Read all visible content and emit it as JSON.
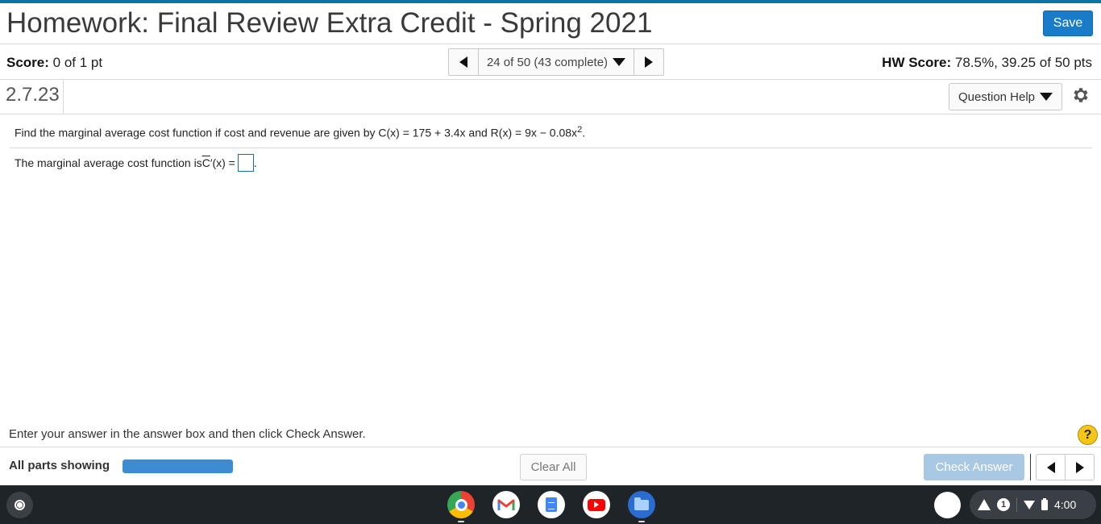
{
  "header": {
    "title": "Homework: Final Review Extra Credit - Spring 2021",
    "save_label": "Save"
  },
  "score_bar": {
    "score_label": "Score:",
    "score_value": "0 of 1 pt",
    "question_position": "24 of 50 (43 complete)",
    "hw_score_label": "HW Score:",
    "hw_score_value": "78.5%, 39.25 of 50 pts"
  },
  "question_bar": {
    "question_id": "2.7.23",
    "help_label": "Question Help"
  },
  "question": {
    "prompt_text": "Find the marginal average cost function if cost and revenue are given by C(x) = 175 + 3.4x and R(x) = 9x − 0.08x",
    "prompt_exponent": "2",
    "prompt_end": ".",
    "answer_prefix": "The marginal average cost function is ",
    "answer_symbol": "C",
    "answer_suffix": "′(x) =",
    "answer_value": "",
    "answer_end": "."
  },
  "instruction": "Enter your answer in the answer box and then click Check Answer.",
  "footer": {
    "parts_label": "All parts showing",
    "progress_fraction": 1.0,
    "clear_label": "Clear All",
    "check_label": "Check Answer"
  },
  "shelf": {
    "apps": [
      "chrome-icon",
      "gmail-icon",
      "docs-icon",
      "youtube-icon",
      "files-icon"
    ],
    "notification_count": "1",
    "time": "4:00"
  },
  "colors": {
    "accent": "#0b74a5",
    "save_button": "#1a7bc8",
    "progress_fill": "#3d8bd0",
    "check_button_disabled": "#a9c8e4",
    "shelf_bg": "#1f2428"
  }
}
